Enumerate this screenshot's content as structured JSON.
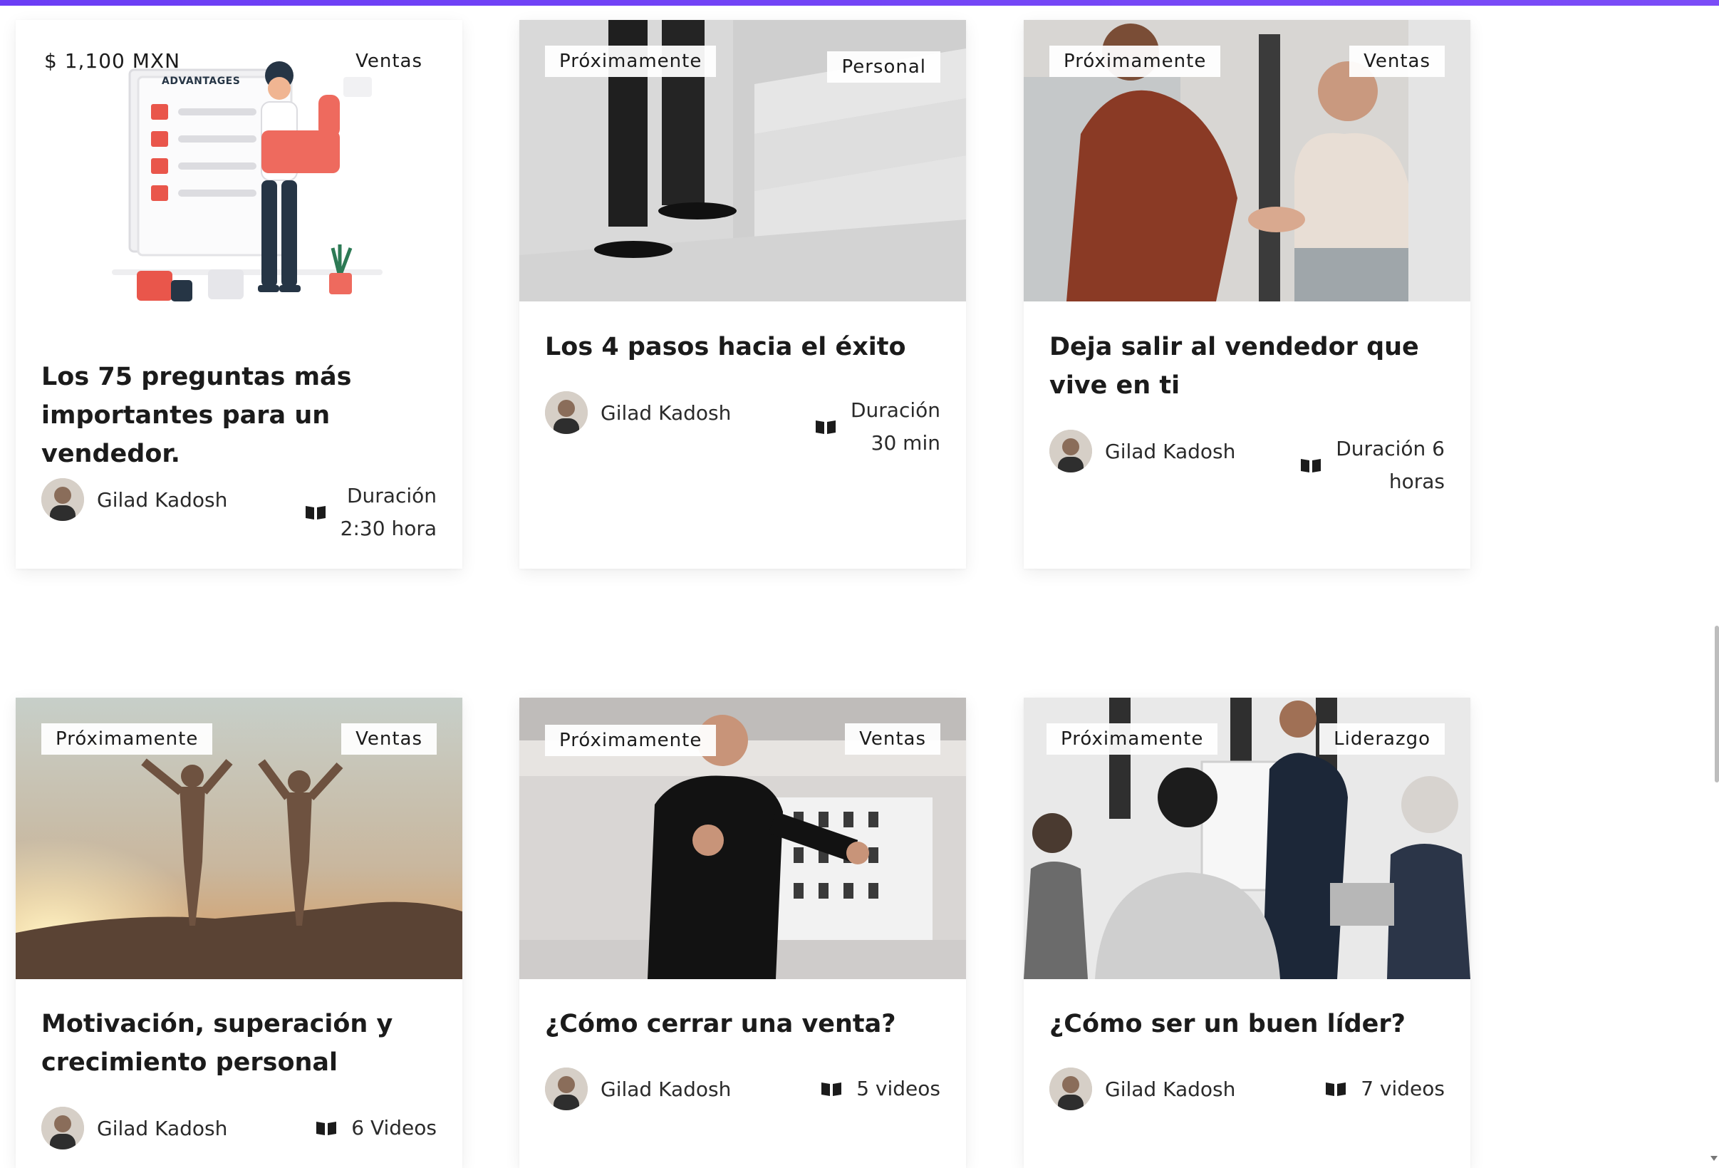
{
  "cards": [
    {
      "tag_left": "$ 1,100 MXN",
      "tag_right": "Ventas",
      "illustration_label": "ADVANTAGES",
      "title": "Los 75 preguntas más importantes para un vendedor.",
      "author": "Gilad Kadosh",
      "meta_icon": "book-icon",
      "meta": "Duración\n2:30 hora"
    },
    {
      "tag_left": "Próximamente",
      "tag_right": "Personal",
      "title": "Los 4 pasos hacia el éxito",
      "author": "Gilad Kadosh",
      "meta_icon": "book-icon",
      "meta": "Duración\n30 min"
    },
    {
      "tag_left": "Próximamente",
      "tag_right": "Ventas",
      "title": "Deja salir al vendedor que vive en ti",
      "author": "Gilad Kadosh",
      "meta_icon": "book-icon",
      "meta": "Duración 6\nhoras"
    },
    {
      "tag_left": "Próximamente",
      "tag_right": "Ventas",
      "title": "Motivación, superación y crecimiento personal",
      "author": "Gilad Kadosh",
      "meta_icon": "book-icon",
      "meta": "6 Videos"
    },
    {
      "tag_left": "Próximamente",
      "tag_right": "Ventas",
      "title": "¿Cómo cerrar una venta?",
      "author": "Gilad Kadosh",
      "meta_icon": "book-icon",
      "meta": "5 videos"
    },
    {
      "tag_left": "Próximamente",
      "tag_right": "Liderazgo",
      "title": "¿Cómo ser un buen líder?",
      "author": "Gilad Kadosh",
      "meta_icon": "book-icon",
      "meta": "7 videos"
    }
  ],
  "colors": {
    "accent": "#6b3df5",
    "text": "#1b1b1b",
    "checkbox": "#e9564b"
  }
}
